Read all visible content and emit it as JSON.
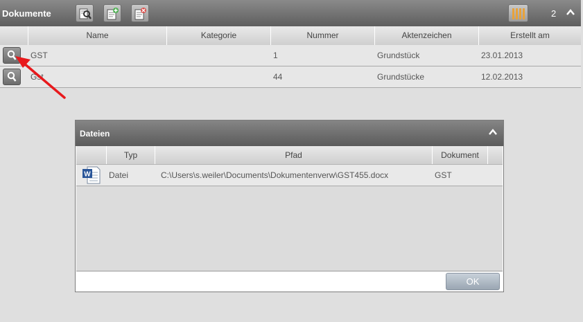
{
  "panel": {
    "title": "Dokumente",
    "count": "2",
    "toolbar": {
      "search_icon": "search-document-icon",
      "add_icon": "add-document-icon",
      "delete_icon": "delete-document-icon",
      "columns_icon": "column-chooser-icon"
    }
  },
  "grid": {
    "columns": [
      "Name",
      "Kategorie",
      "Nummer",
      "Aktenzeichen",
      "Erstellt am"
    ],
    "rows": [
      {
        "name": "GST",
        "kategorie": "",
        "nummer": "1",
        "aktenzeichen": "Grundstück",
        "erstellt": "23.01.2013"
      },
      {
        "name": "Gst",
        "kategorie": "",
        "nummer": "44",
        "aktenzeichen": "Grundstücke",
        "erstellt": "12.02.2013"
      }
    ]
  },
  "dialog": {
    "title": "Dateien",
    "columns": [
      "Typ",
      "Pfad",
      "Dokument"
    ],
    "rows": [
      {
        "icon": "word-document-icon",
        "typ": "Datei",
        "pfad": "C:\\Users\\s.weiler\\Documents\\Dokumentenverw\\GST455.docx",
        "dokument": "GST"
      }
    ],
    "ok_label": "OK"
  },
  "colors": {
    "header_dark": "#5e5e5e",
    "annotation_arrow": "#e8191c",
    "word_blue": "#2a5699"
  }
}
